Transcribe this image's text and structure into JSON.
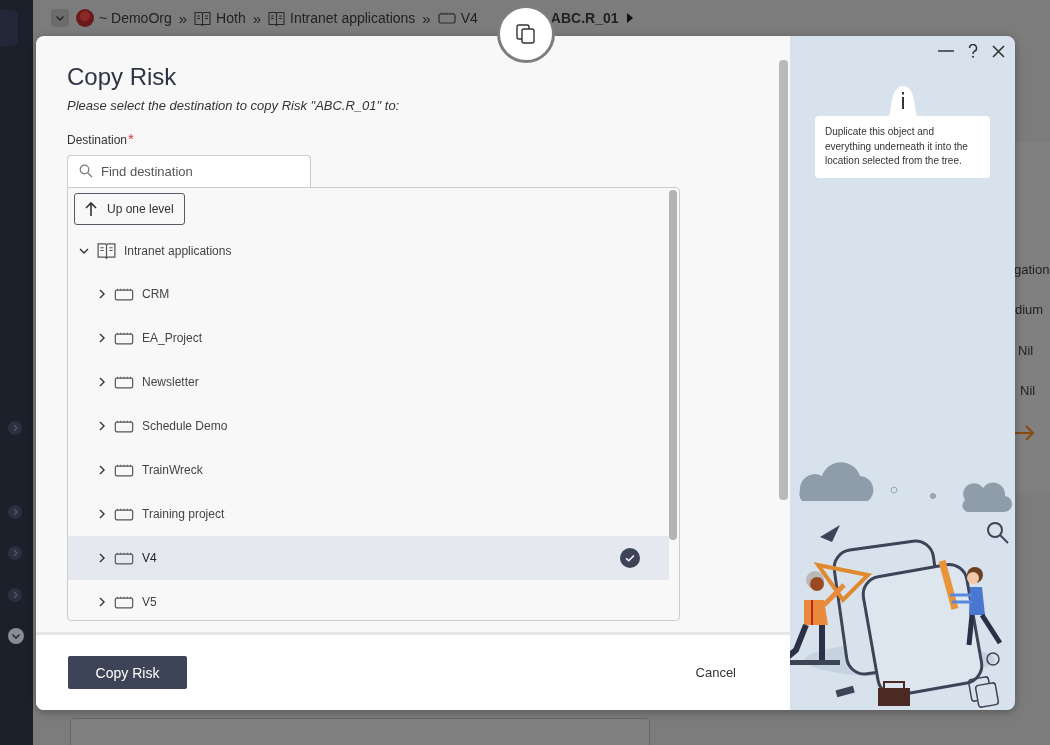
{
  "breadcrumb": [
    {
      "kind": "org",
      "label": "~ DemoOrg",
      "separator": "»"
    },
    {
      "kind": "book",
      "label": "Hoth",
      "separator": "»"
    },
    {
      "kind": "book",
      "label": "Intranet applications",
      "separator": "»"
    },
    {
      "kind": "folder",
      "label": "V4"
    },
    {
      "kind": "risk",
      "label": "ABC.R_01"
    }
  ],
  "background_cells": [
    "gation",
    "dium",
    "Nil",
    "Nil"
  ],
  "dialog": {
    "title": "Copy Risk",
    "subtitle": "Please select the destination to copy Risk \"ABC.R_01\" to:",
    "destination_label": "Destination",
    "required_mark": "*",
    "search": {
      "placeholder": "Find destination"
    },
    "up_button": "Up one level",
    "tree": {
      "label": "Intranet applications",
      "kind": "book",
      "expanded": true,
      "children": [
        {
          "label": "CRM",
          "kind": "folder",
          "expanded": false,
          "selected": false
        },
        {
          "label": "EA_Project",
          "kind": "folder",
          "expanded": false,
          "selected": false
        },
        {
          "label": "Newsletter",
          "kind": "folder",
          "expanded": false,
          "selected": false
        },
        {
          "label": "Schedule Demo",
          "kind": "folder",
          "expanded": false,
          "selected": false
        },
        {
          "label": "TrainWreck",
          "kind": "folder",
          "expanded": false,
          "selected": false
        },
        {
          "label": "Training project",
          "kind": "folder",
          "expanded": false,
          "selected": false
        },
        {
          "label": "V4",
          "kind": "folder",
          "expanded": false,
          "selected": true
        },
        {
          "label": "V5",
          "kind": "folder",
          "expanded": false,
          "selected": false
        }
      ]
    },
    "primary_button": "Copy Risk",
    "cancel_button": "Cancel",
    "help_text": "Duplicate this object and everything underneath it into the location selected from the tree."
  }
}
